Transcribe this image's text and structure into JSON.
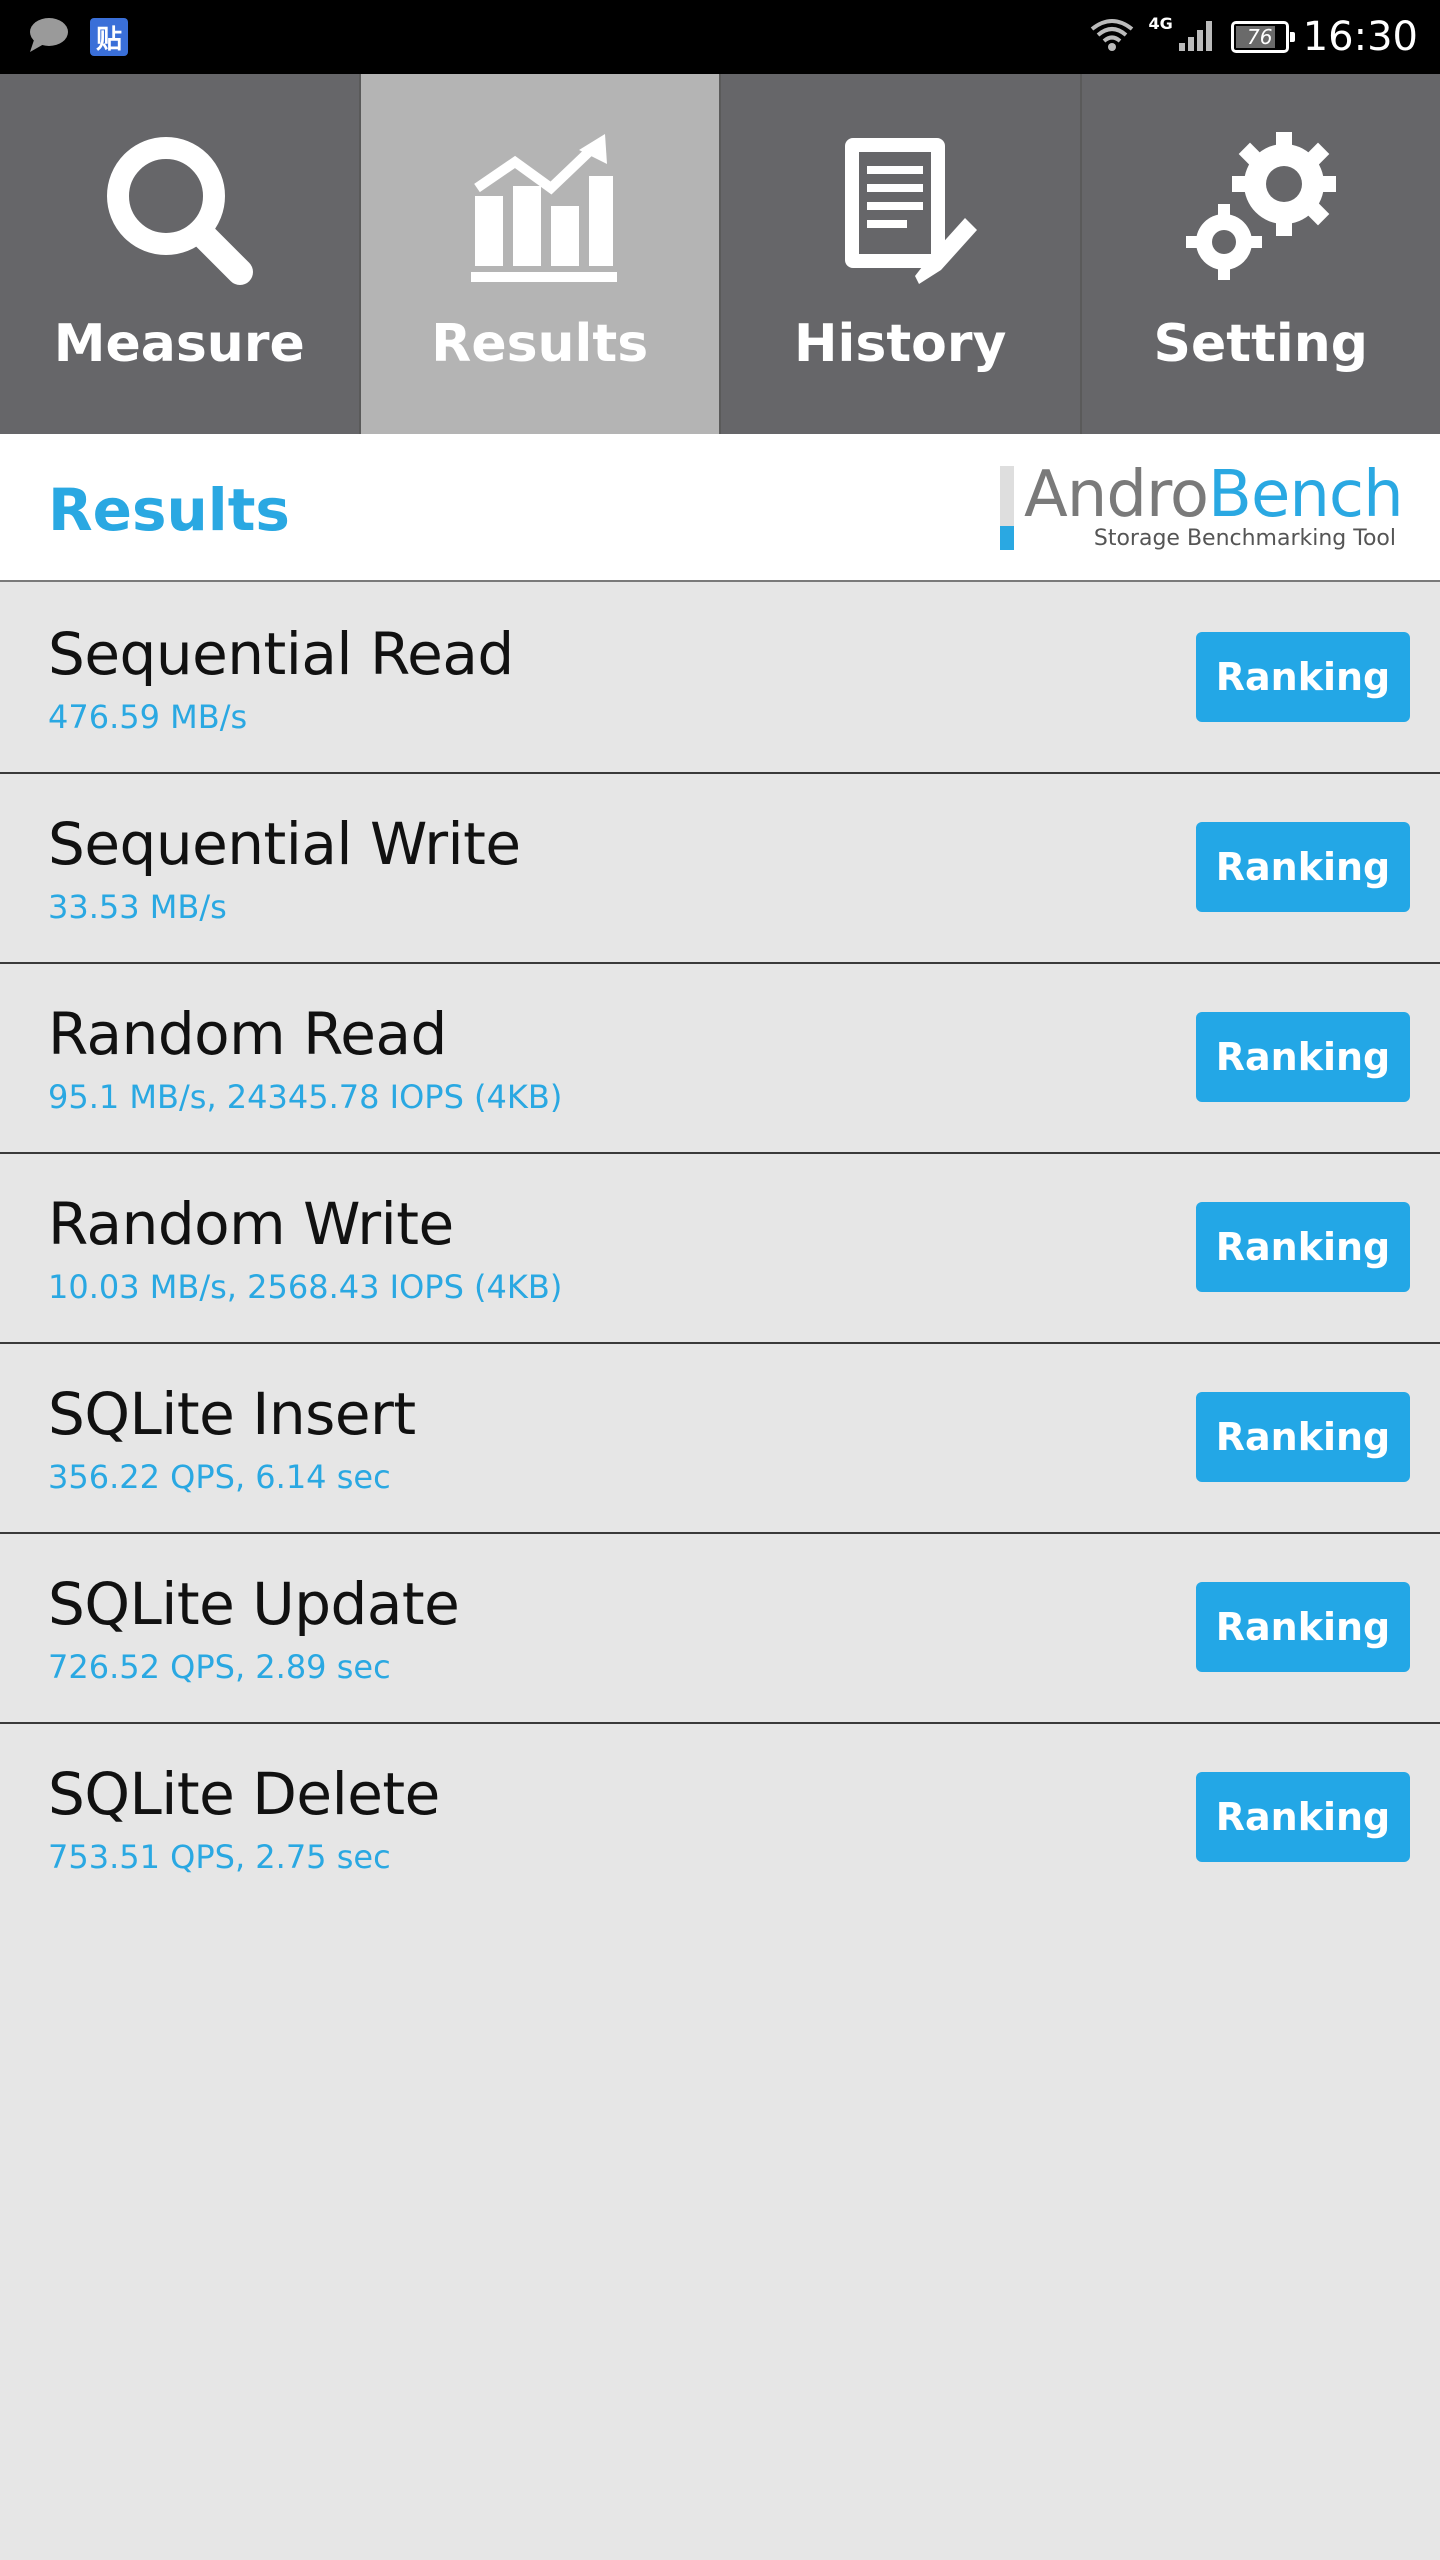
{
  "status_bar": {
    "time": "16:30",
    "network": "4G",
    "battery": "76",
    "battery_level": 0.76,
    "notification_icons": [
      "message-icon",
      "tieba-icon"
    ],
    "notification_tieba_text": "贴"
  },
  "tabs": [
    {
      "label": "Measure",
      "icon": "search-icon",
      "active": false
    },
    {
      "label": "Results",
      "icon": "chart-icon",
      "active": true
    },
    {
      "label": "History",
      "icon": "document-icon",
      "active": false
    },
    {
      "label": "Setting",
      "icon": "gear-icon",
      "active": false
    }
  ],
  "header": {
    "title": "Results",
    "logo_part1": "Andro",
    "logo_part2": "Bench",
    "logo_subtitle": "Storage Benchmarking Tool"
  },
  "results": [
    {
      "title": "Sequential Read",
      "value": "476.59 MB/s",
      "button": "Ranking"
    },
    {
      "title": "Sequential Write",
      "value": "33.53 MB/s",
      "button": "Ranking"
    },
    {
      "title": "Random Read",
      "value": "95.1 MB/s, 24345.78 IOPS (4KB)",
      "button": "Ranking"
    },
    {
      "title": "Random Write",
      "value": "10.03 MB/s, 2568.43 IOPS (4KB)",
      "button": "Ranking"
    },
    {
      "title": "SQLite Insert",
      "value": "356.22 QPS, 6.14 sec",
      "button": "Ranking"
    },
    {
      "title": "SQLite Update",
      "value": "726.52 QPS, 2.89 sec",
      "button": "Ranking"
    },
    {
      "title": "SQLite Delete",
      "value": "753.51 QPS, 2.75 sec",
      "button": "Ranking"
    }
  ],
  "colors": {
    "accent": "#2aa8e2",
    "tab_bg": "#666669",
    "tab_active_bg": "#b4b4b4",
    "list_bg": "#e6e6e6"
  }
}
